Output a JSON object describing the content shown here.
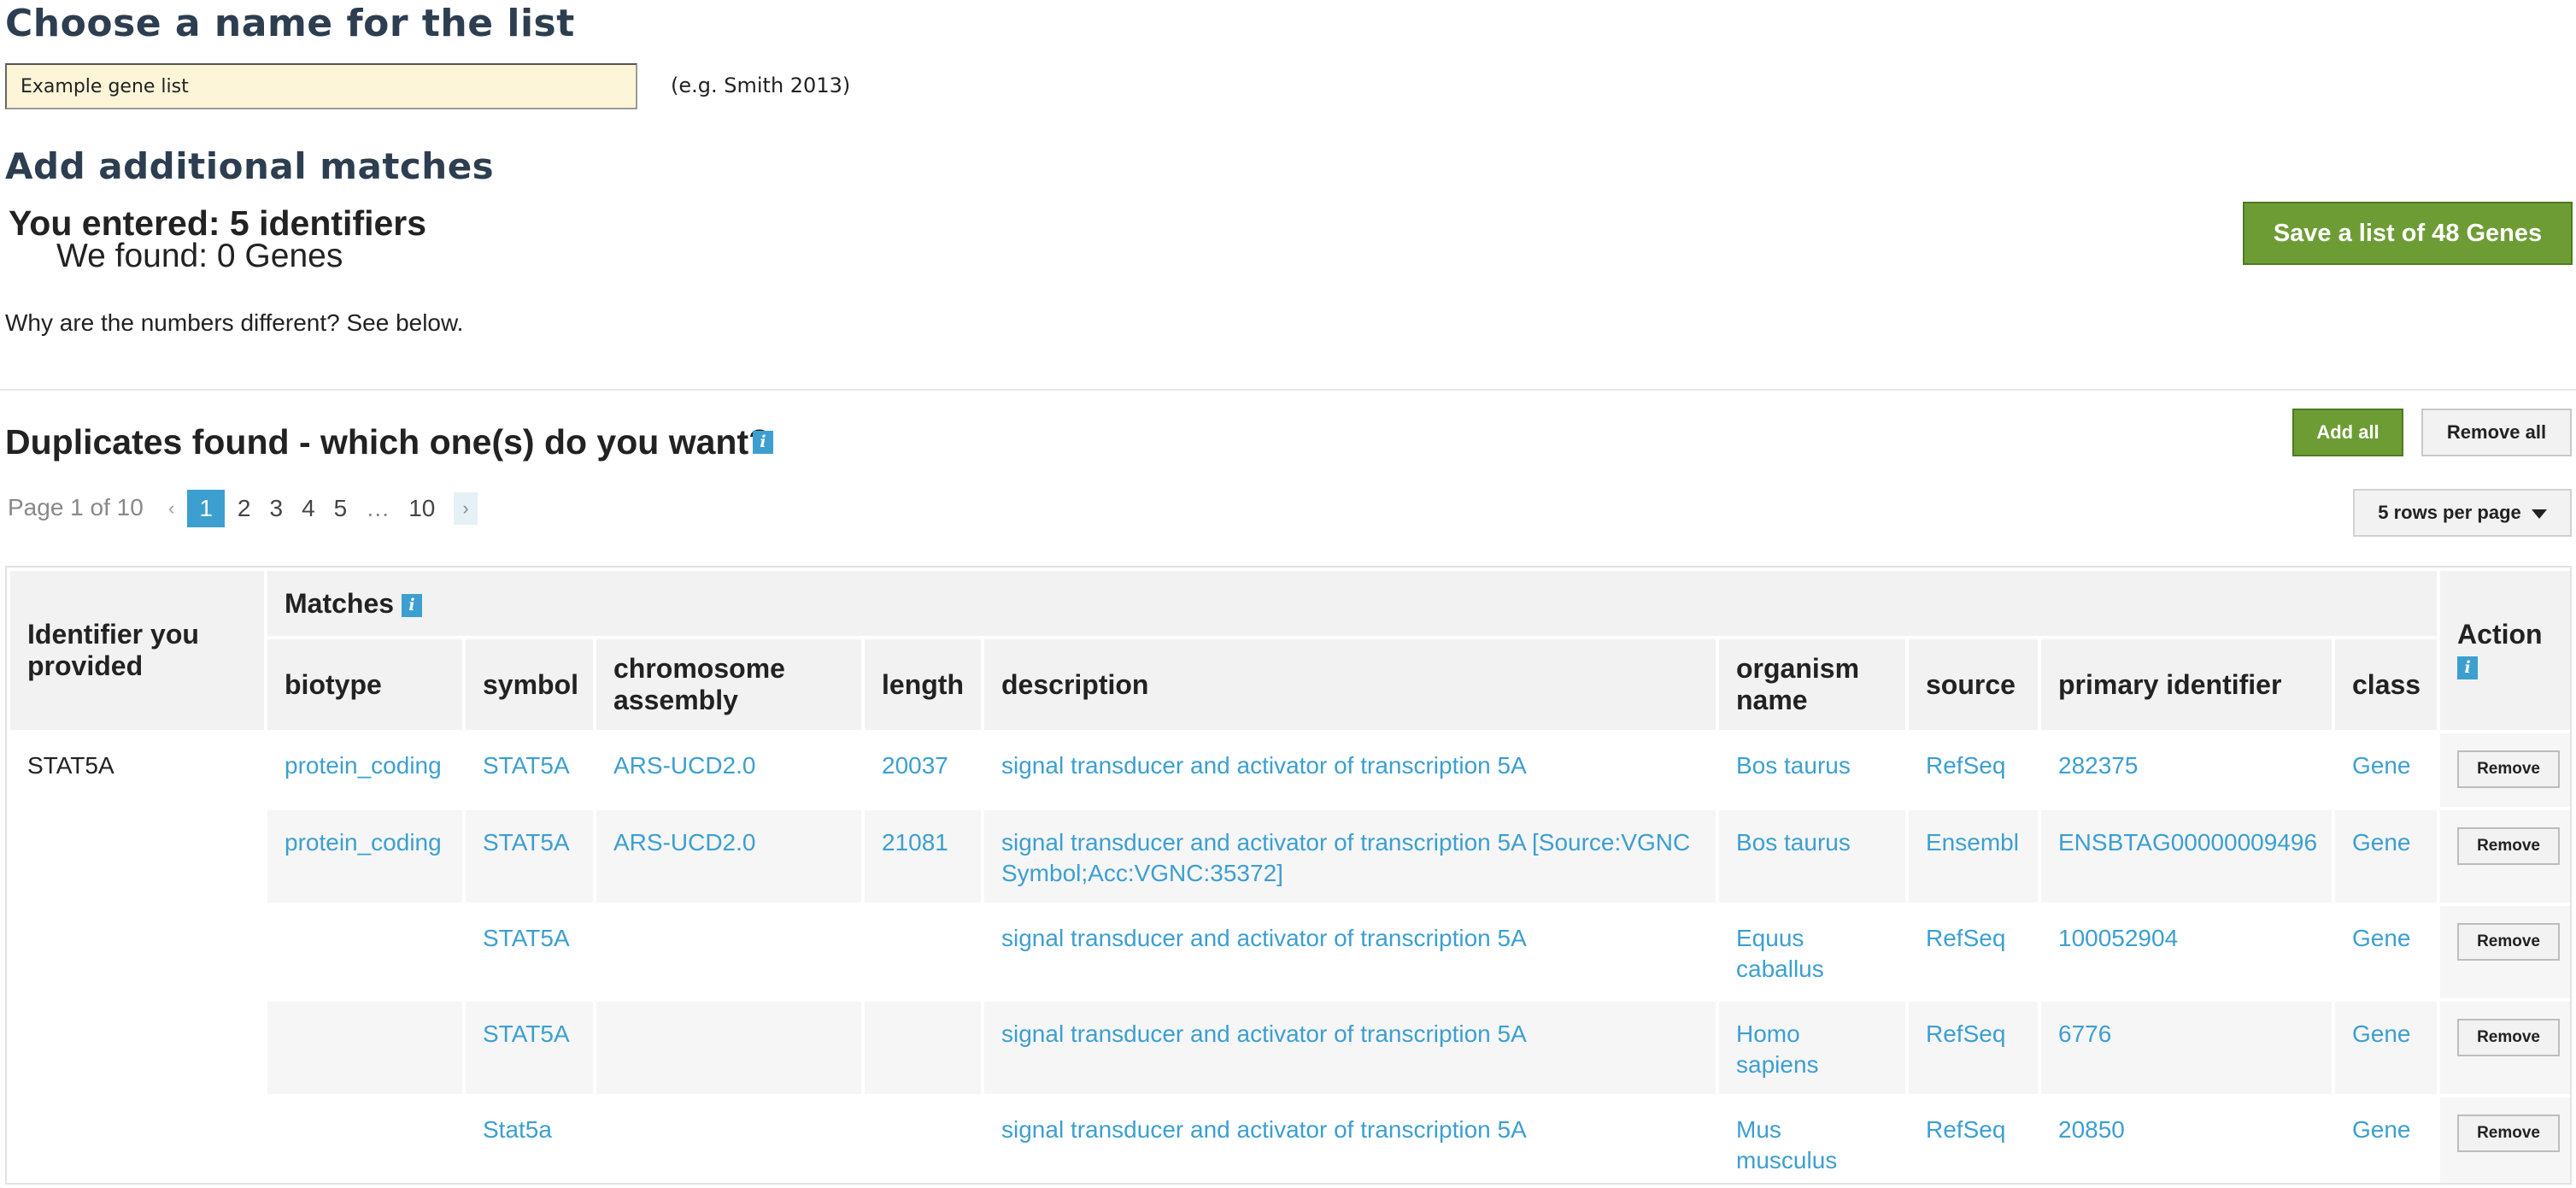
{
  "list_name": {
    "heading": "Choose a name for the list",
    "value": "Example gene list",
    "hint": "(e.g. Smith 2013)"
  },
  "add_matches": {
    "heading": "Add additional matches",
    "entered": "You entered: 5 identifiers",
    "found": "We found: 0 Genes",
    "why": "Why are the numbers different? See below.",
    "save_button": "Save a list of 48 Genes"
  },
  "duplicates": {
    "title": "Duplicates found - which one(s) do you want?",
    "info_icon": "i",
    "add_all": "Add all",
    "remove_all": "Remove all",
    "page_status": "Page 1 of 10",
    "pager": {
      "prev": "‹",
      "pages": [
        "1",
        "2",
        "3",
        "4",
        "5"
      ],
      "ellipsis": "…",
      "last": "10",
      "next": "›",
      "current": "1"
    },
    "rows_per_page": "5 rows per page"
  },
  "table": {
    "header_identifier": "Identifier you provided",
    "header_matches": "Matches",
    "header_action": "Action",
    "columns": [
      "biotype",
      "symbol",
      "chromosome assembly",
      "length",
      "description",
      "organism name",
      "source",
      "primary identifier",
      "class"
    ],
    "identifier": "STAT5A",
    "remove_label": "Remove",
    "rows": [
      {
        "biotype": "protein_coding",
        "symbol": "STAT5A",
        "assembly": "ARS-UCD2.0",
        "length": "20037",
        "description": "signal transducer and activator of transcription 5A",
        "organism": "Bos taurus",
        "source": "RefSeq",
        "primary": "282375",
        "class": "Gene"
      },
      {
        "biotype": "protein_coding",
        "symbol": "STAT5A",
        "assembly": "ARS-UCD2.0",
        "length": "21081",
        "description": "signal transducer and activator of transcription 5A [Source:VGNC Symbol;Acc:VGNC:35372]",
        "organism": "Bos taurus",
        "source": "Ensembl",
        "primary": "ENSBTAG00000009496",
        "class": "Gene"
      },
      {
        "biotype": "",
        "symbol": "STAT5A",
        "assembly": "",
        "length": "",
        "description": "signal transducer and activator of transcription 5A",
        "organism": "Equus caballus",
        "source": "RefSeq",
        "primary": "100052904",
        "class": "Gene"
      },
      {
        "biotype": "",
        "symbol": "STAT5A",
        "assembly": "",
        "length": "",
        "description": "signal transducer and activator of transcription 5A",
        "organism": "Homo sapiens",
        "source": "RefSeq",
        "primary": "6776",
        "class": "Gene"
      },
      {
        "biotype": "",
        "symbol": "Stat5a",
        "assembly": "",
        "length": "",
        "description": "signal transducer and activator of transcription 5A",
        "organism": "Mus musculus",
        "source": "RefSeq",
        "primary": "20850",
        "class": "Gene"
      }
    ]
  },
  "colors": {
    "accent": "#3d9fcf",
    "save_green": "#6d9c35",
    "input_bg": "#fdf5d8",
    "heading": "#2d3e50"
  }
}
